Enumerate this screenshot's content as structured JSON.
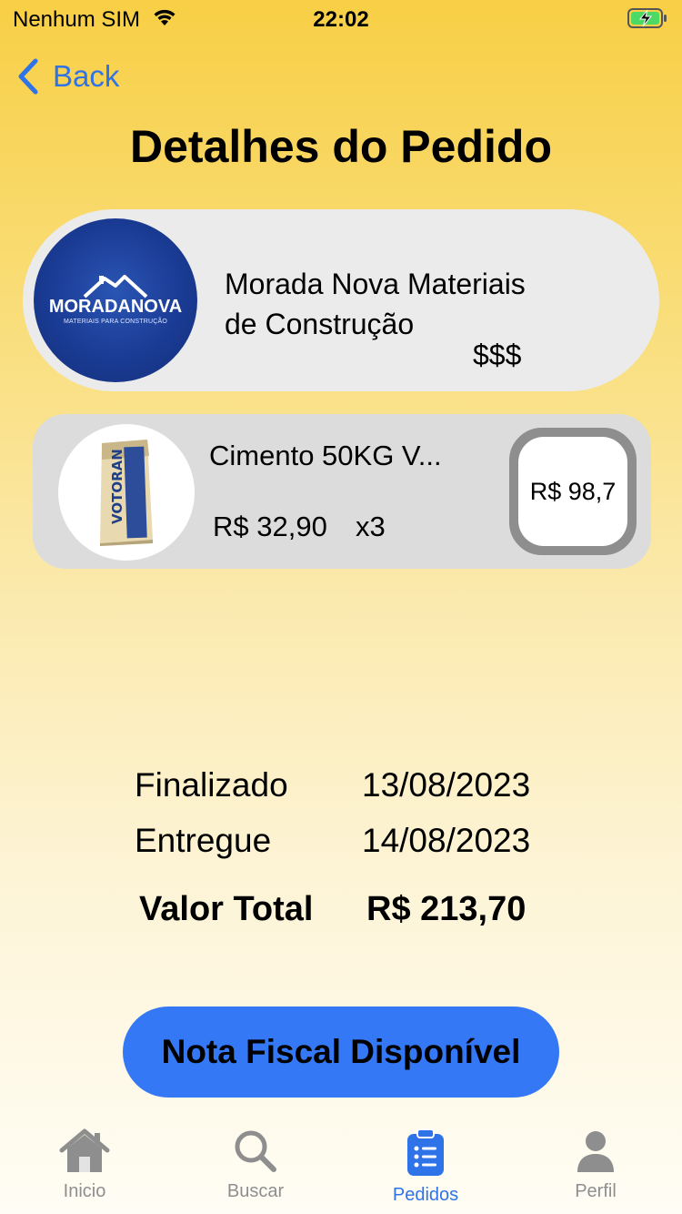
{
  "status_bar": {
    "carrier": "Nenhum SIM",
    "time": "22:02"
  },
  "nav": {
    "back_label": "Back"
  },
  "page_title": "Detalhes do Pedido",
  "store": {
    "name_line1": "Morada Nova Materiais",
    "name_line2": "de Construção",
    "price_level": "$$$",
    "logo_text": "MORADANOVA",
    "logo_subtext": "MATERIAIS PARA CONSTRUÇÃO"
  },
  "product": {
    "name": "Cimento 50KG V...",
    "unit_price": "R$ 32,90",
    "quantity": "x3",
    "total": "R$ 98,7",
    "bag_text": "VOTORAN"
  },
  "details": {
    "finalizado_label": "Finalizado",
    "finalizado_date": "13/08/2023",
    "entregue_label": "Entregue",
    "entregue_date": "14/08/2023",
    "total_label": "Valor Total",
    "total_value": "R$ 213,70"
  },
  "invoice_button_label": "Nota Fiscal Disponível",
  "tabs": [
    {
      "label": "Inicio",
      "icon": "house-icon"
    },
    {
      "label": "Buscar",
      "icon": "search-icon"
    },
    {
      "label": "Pedidos",
      "icon": "clipboard-list-icon"
    },
    {
      "label": "Perfil",
      "icon": "person-icon"
    }
  ],
  "colors": {
    "accent": "#2f73e8",
    "button": "#3478f6",
    "inactive": "#8e8e8e"
  }
}
